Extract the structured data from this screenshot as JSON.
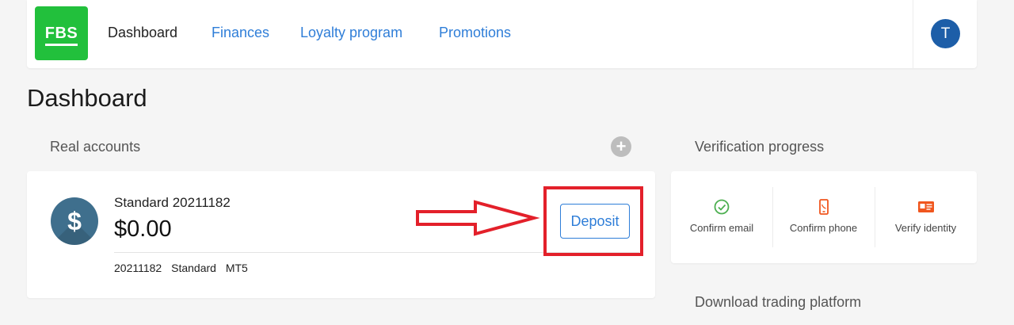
{
  "header": {
    "logo_text": "FBS",
    "nav": [
      {
        "label": "Dashboard"
      },
      {
        "label": "Finances"
      },
      {
        "label": "Loyalty program"
      },
      {
        "label": "Promotions"
      }
    ],
    "avatar_initial": "T"
  },
  "page": {
    "title": "Dashboard"
  },
  "real_accounts": {
    "label": "Real accounts",
    "add_icon": "plus-circle-icon",
    "account": {
      "icon": "dollar-icon",
      "name": "Standard 20211182",
      "balance": "$0.00",
      "meta": [
        "20211182",
        "Standard",
        "MT5"
      ],
      "deposit_label": "Deposit"
    }
  },
  "verification": {
    "label": "Verification progress",
    "items": [
      {
        "label": "Confirm email",
        "icon": "check-circle-icon"
      },
      {
        "label": "Confirm phone",
        "icon": "phone-icon"
      },
      {
        "label": "Verify identity",
        "icon": "id-card-icon"
      }
    ]
  },
  "download": {
    "label": "Download trading platform"
  },
  "colors": {
    "brand_green": "#22c03c",
    "link_blue": "#2f7ed8",
    "avatar_blue": "#1d5ea8",
    "annotation_red": "#e3202a",
    "verify_green": "#4caf50",
    "verify_orange": "#f0561e"
  }
}
